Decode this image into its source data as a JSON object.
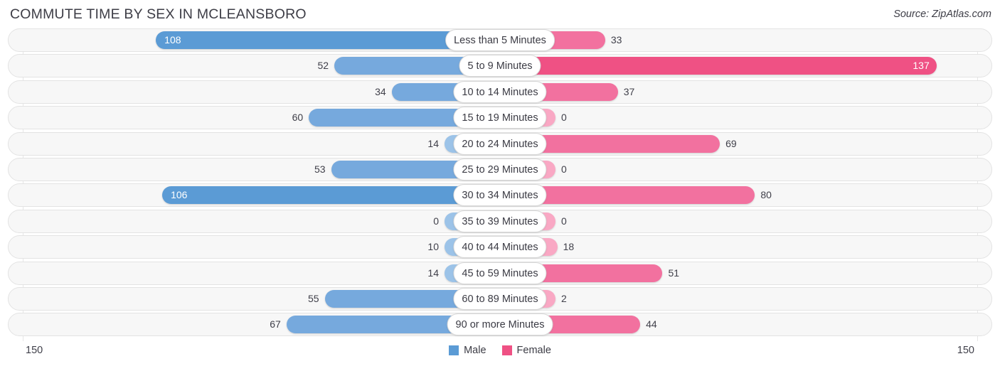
{
  "header": {
    "title": "COMMUTE TIME BY SEX IN MCLEANSBORO",
    "source": "Source: ZipAtlas.com"
  },
  "footer": {
    "axis_left": "150",
    "axis_right": "150",
    "legend": [
      {
        "label": "Male",
        "color": "#5b9bd5"
      },
      {
        "label": "Female",
        "color": "#ef5184"
      }
    ]
  },
  "colors": {
    "male_strong": "#5b9bd5",
    "male_mid": "#76a9dd",
    "male_pale": "#9cc3e8",
    "female_strong": "#ef5184",
    "female_mid": "#f2719f",
    "female_pale": "#f9a8c4",
    "track_bg": "#f7f7f7",
    "track_border": "#e3e3e3",
    "text": "#3b3b44"
  },
  "chart_data": {
    "type": "bar",
    "subtype": "diverging-bidirectional",
    "title": "COMMUTE TIME BY SEX IN MCLEANSBORO",
    "xlabel": "",
    "ylabel": "",
    "xlim": [
      -150,
      150
    ],
    "axis_max": 150,
    "grid": false,
    "legend_position": "bottom-center",
    "categories": [
      "Less than 5 Minutes",
      "5 to 9 Minutes",
      "10 to 14 Minutes",
      "15 to 19 Minutes",
      "20 to 24 Minutes",
      "25 to 29 Minutes",
      "30 to 34 Minutes",
      "35 to 39 Minutes",
      "40 to 44 Minutes",
      "45 to 59 Minutes",
      "60 to 89 Minutes",
      "90 or more Minutes"
    ],
    "series": [
      {
        "name": "Male",
        "direction": "left",
        "color": "#5b9bd5",
        "values": [
          108,
          52,
          34,
          60,
          14,
          53,
          106,
          0,
          10,
          14,
          55,
          67
        ]
      },
      {
        "name": "Female",
        "direction": "right",
        "color": "#ef5184",
        "values": [
          33,
          137,
          37,
          0,
          69,
          0,
          80,
          0,
          18,
          51,
          2,
          44
        ]
      }
    ]
  }
}
